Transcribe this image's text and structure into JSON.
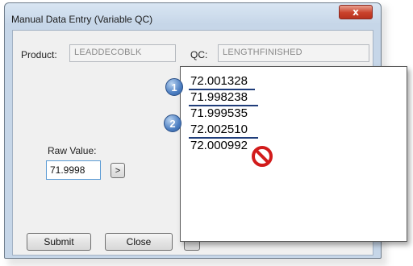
{
  "window": {
    "title": "Manual Data Entry (Variable QC)",
    "close_label": "x"
  },
  "product": {
    "label": "Product:",
    "value": "LEADDECOBLK"
  },
  "qc": {
    "label": "QC:",
    "value": "LENGTHFINISHED"
  },
  "raw": {
    "label": "Raw Value:",
    "value": "71.9998",
    "go_label": ">"
  },
  "buttons": {
    "submit": "Submit",
    "close": "Close"
  },
  "popup": {
    "values": [
      "72.001328",
      "71.998238",
      "71.999535",
      "72.002510",
      "72.000992"
    ],
    "badges": [
      "1",
      "2"
    ]
  },
  "colors": {
    "underline": "#1f3d7a",
    "badge_blue": "#4d7fc2",
    "no_symbol_red": "#d21b1b"
  },
  "icons": [
    "close-icon",
    "number-badge-1",
    "number-badge-2",
    "no-entry-icon"
  ]
}
